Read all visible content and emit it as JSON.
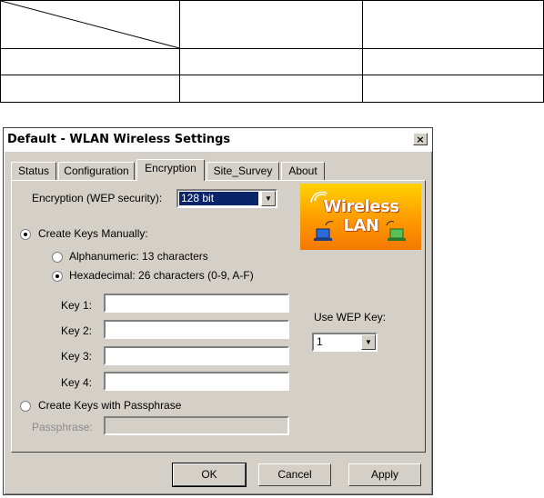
{
  "dialog": {
    "title": "Default - WLAN Wireless Settings",
    "close_glyph": "×",
    "tabs": [
      "Status",
      "Configuration",
      "Encryption",
      "Site_Survey",
      "About"
    ],
    "active_tab": "Encryption",
    "encryption_label": "Encryption (WEP security):",
    "encryption_value": "128 bit",
    "create_manual_label": "Create Keys Manually:",
    "alnum_label": "Alphanumeric: 13 characters",
    "hex_label": "Hexadecimal: 26 characters (0-9, A-F)",
    "keys": [
      {
        "label": "Key 1:",
        "value": ""
      },
      {
        "label": "Key 2:",
        "value": ""
      },
      {
        "label": "Key 3:",
        "value": ""
      },
      {
        "label": "Key 4:",
        "value": ""
      }
    ],
    "passphrase_radio_label": "Create Keys with Passphrase",
    "passphrase_label": "Passphrase:",
    "passphrase_value": "",
    "use_wep_key_label": "Use WEP Key:",
    "use_wep_key_value": "1",
    "logo_text": "Wireless LAN",
    "buttons": {
      "ok": "OK",
      "cancel": "Cancel",
      "apply": "Apply"
    },
    "radio_state": {
      "create_manual": true,
      "alnum": false,
      "hex": true,
      "passphrase": false
    },
    "colors": {
      "face": "#d4d0c8",
      "selection": "#0a246a",
      "logo_top": "#ffd200",
      "logo_bottom": "#f47700"
    }
  }
}
